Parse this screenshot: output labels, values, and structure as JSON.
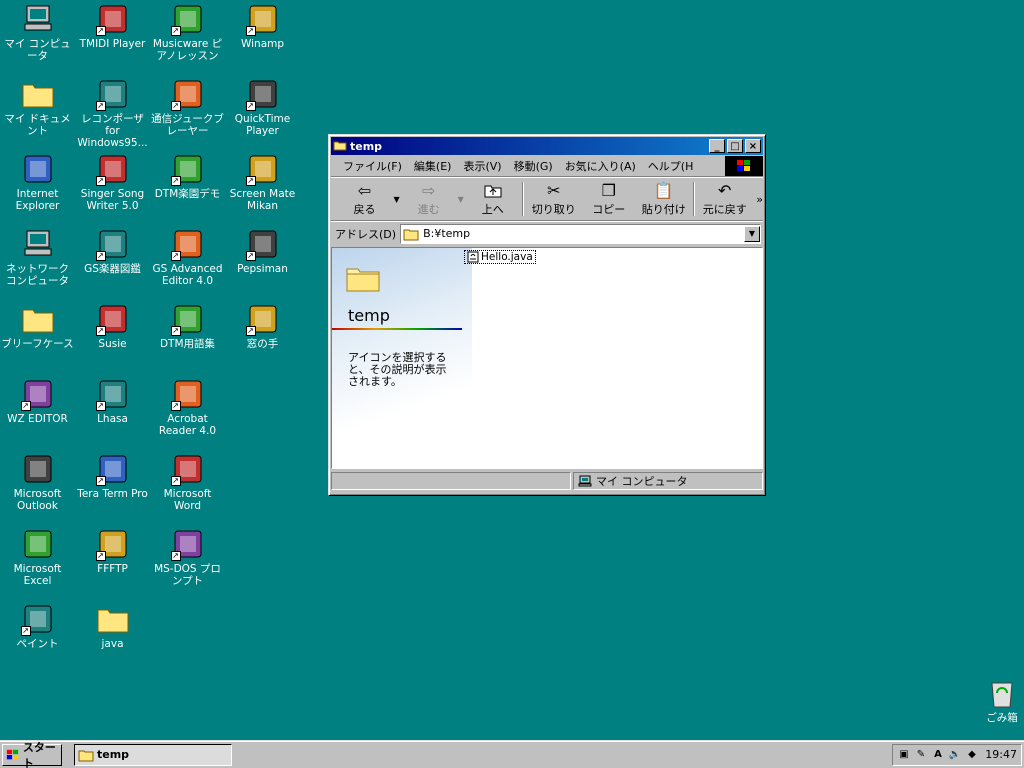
{
  "desktop": {
    "icons": [
      {
        "label": "マイ コンピュータ",
        "icon": "my-computer-icon"
      },
      {
        "label": "TMIDI Player",
        "icon": "tmidi-icon"
      },
      {
        "label": "Musicware ピアノレッスン",
        "icon": "musicware-icon"
      },
      {
        "label": "Winamp",
        "icon": "winamp-icon"
      },
      {
        "label": "マイ ドキュメント",
        "icon": "my-documents-icon"
      },
      {
        "label": "レコンポーザ for Windows95...",
        "icon": "recomposer-icon"
      },
      {
        "label": "通信ジュークブレーヤー",
        "icon": "jukebox-icon"
      },
      {
        "label": "QuickTime Player",
        "icon": "quicktime-icon"
      },
      {
        "label": "Internet Explorer",
        "icon": "ie-icon"
      },
      {
        "label": "Singer Song Writer 5.0",
        "icon": "singer-song-writer-icon"
      },
      {
        "label": "DTM楽園デモ",
        "icon": "dtm-rakuen-icon"
      },
      {
        "label": "Screen Mate Mikan",
        "icon": "mikan-icon"
      },
      {
        "label": "ネットワーク コンピュータ",
        "icon": "network-icon"
      },
      {
        "label": "GS楽器図鑑",
        "icon": "gs-instruments-icon"
      },
      {
        "label": "GS Advanced Editor 4.0",
        "icon": "gs-editor-icon"
      },
      {
        "label": "Pepsiman",
        "icon": "pepsiman-icon"
      },
      {
        "label": "ブリーフケース",
        "icon": "briefcase-icon"
      },
      {
        "label": "Susie",
        "icon": "susie-icon"
      },
      {
        "label": "DTM用語集",
        "icon": "dtm-glossary-icon"
      },
      {
        "label": "窓の手",
        "icon": "madonote-icon"
      },
      {
        "label": "WZ EDITOR",
        "icon": "wz-editor-icon"
      },
      {
        "label": "Lhasa",
        "icon": "lhasa-icon"
      },
      {
        "label": "Acrobat Reader 4.0",
        "icon": "acrobat-icon"
      },
      {
        "label": "Microsoft Outlook",
        "icon": "outlook-icon"
      },
      {
        "label": "Tera Term Pro",
        "icon": "teraterm-icon"
      },
      {
        "label": "Microsoft Word",
        "icon": "word-icon"
      },
      {
        "label": "Microsoft Excel",
        "icon": "excel-icon"
      },
      {
        "label": "FFFTP",
        "icon": "ffftp-icon"
      },
      {
        "label": "MS-DOS プロンプト",
        "icon": "msdos-icon"
      },
      {
        "label": "ペイント",
        "icon": "paint-icon"
      },
      {
        "label": "java",
        "icon": "folder-icon"
      },
      {
        "label": "ごみ箱",
        "icon": "recycle-bin-icon"
      }
    ]
  },
  "window": {
    "title": "temp",
    "menu": [
      "ファイル(F)",
      "編集(E)",
      "表示(V)",
      "移動(G)",
      "お気に入り(A)",
      "ヘルプ(H"
    ],
    "toolbar": {
      "back": "戻る",
      "forward": "進む",
      "up": "上へ",
      "cut": "切り取り",
      "copy": "コピー",
      "paste": "貼り付け",
      "undo": "元に戻す"
    },
    "address": {
      "label": "アドレス(D)",
      "value": "B:¥temp"
    },
    "panel": {
      "folder_title": "temp",
      "hint": "アイコンを選択すると、その説明が表示されます。"
    },
    "files": [
      {
        "name": "Hello.java"
      }
    ],
    "status": {
      "location": "マイ コンピュータ"
    }
  },
  "taskbar": {
    "start_label": "スタート",
    "task_label": "temp",
    "clock": "19:47"
  }
}
